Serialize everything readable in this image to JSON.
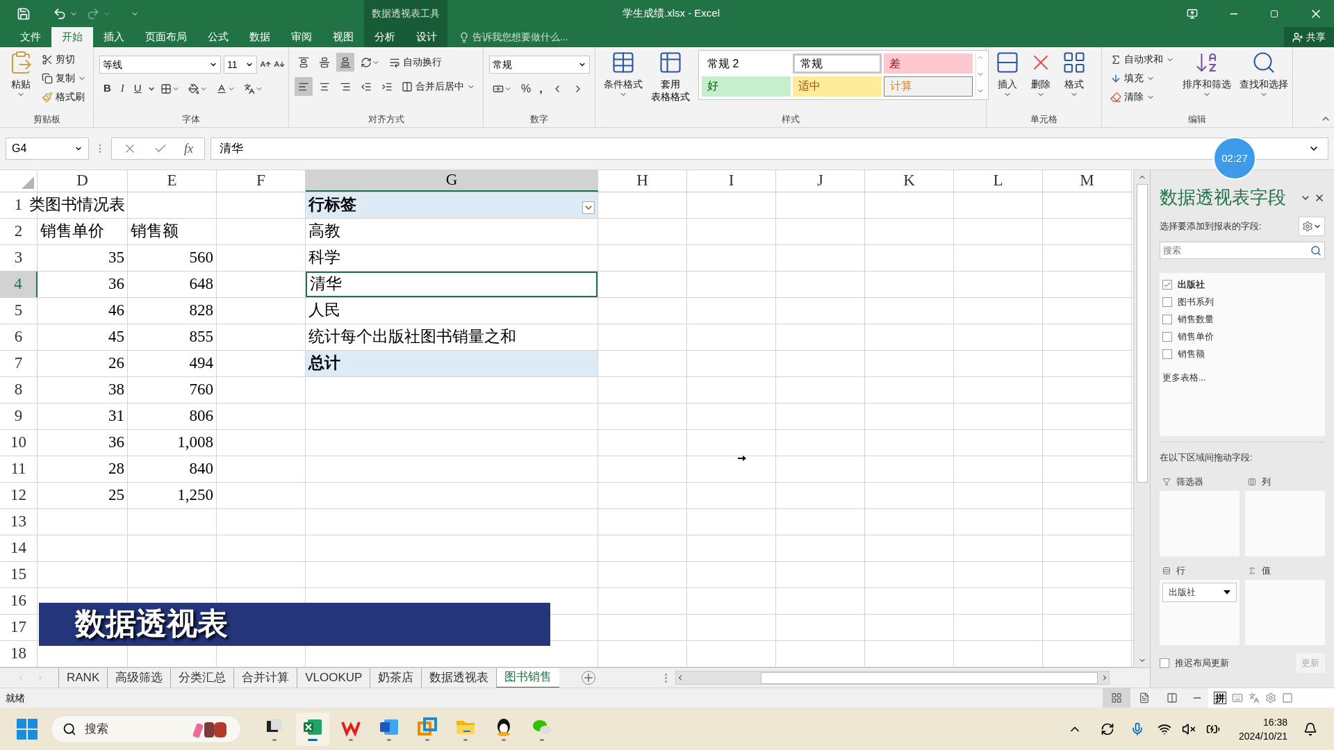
{
  "window": {
    "title": "学生成绩.xlsx - Excel",
    "context_tools": "数据透视表工具",
    "share": "共享"
  },
  "menu_tabs": [
    {
      "label": "文件",
      "selected": false,
      "contextual": false
    },
    {
      "label": "开始",
      "selected": true,
      "contextual": false
    },
    {
      "label": "插入",
      "selected": false,
      "contextual": false
    },
    {
      "label": "页面布局",
      "selected": false,
      "contextual": false
    },
    {
      "label": "公式",
      "selected": false,
      "contextual": false
    },
    {
      "label": "数据",
      "selected": false,
      "contextual": false
    },
    {
      "label": "审阅",
      "selected": false,
      "contextual": false
    },
    {
      "label": "视图",
      "selected": false,
      "contextual": false
    },
    {
      "label": "分析",
      "selected": false,
      "contextual": true
    },
    {
      "label": "设计",
      "selected": false,
      "contextual": true
    }
  ],
  "tell_me": {
    "placeholder": "告诉我您想要做什么..."
  },
  "ribbon": {
    "clipboard": {
      "label": "剪贴板",
      "paste": "粘贴",
      "cut": "剪切",
      "copy": "复制",
      "format_painter": "格式刷"
    },
    "font": {
      "label": "字体",
      "font_name": "等线",
      "font_size": "11",
      "bold": "B",
      "italic": "I",
      "underline": "U"
    },
    "alignment": {
      "label": "对齐方式",
      "wrap_text": "自动换行",
      "merge_center": "合并后居中",
      "vertical": [
        {
          "selected": false
        },
        {
          "selected": false
        },
        {
          "selected": true
        }
      ],
      "horizontal": [
        {
          "selected": true
        },
        {
          "selected": false
        },
        {
          "selected": false
        }
      ]
    },
    "number": {
      "label": "数字",
      "format": "常规",
      "percent": "%",
      "comma": ","
    },
    "styles": {
      "label": "样式",
      "conditional": "条件格式",
      "table_format": [
        "套用",
        "表格格式"
      ],
      "gallery": [
        {
          "text": "常规 2",
          "kind": "normal2",
          "selected": false
        },
        {
          "text": "常规",
          "kind": "normal",
          "selected": true
        },
        {
          "text": "差",
          "kind": "bad",
          "selected": false
        },
        {
          "text": "好",
          "kind": "good",
          "selected": false
        },
        {
          "text": "适中",
          "kind": "neutral",
          "selected": false
        },
        {
          "text": "计算",
          "kind": "calc",
          "selected": false
        }
      ]
    },
    "cells": {
      "label": "单元格",
      "buttons": [
        "插入",
        "删除",
        "格式"
      ]
    },
    "editing": {
      "label": "编辑",
      "autosum": "自动求和",
      "fill": "填充",
      "clear": "清除",
      "sort_filter": "排序和筛选",
      "find_select": "查找和选择"
    }
  },
  "formula_bar": {
    "name_box": "G4",
    "fx": "fx",
    "value": "清华"
  },
  "columns": [
    {
      "label": "D",
      "selected": false
    },
    {
      "label": "E",
      "selected": false
    },
    {
      "label": "F",
      "selected": false
    },
    {
      "label": "G",
      "selected": true
    },
    {
      "label": "H",
      "selected": false
    },
    {
      "label": "I",
      "selected": false
    },
    {
      "label": "J",
      "selected": false
    },
    {
      "label": "K",
      "selected": false
    },
    {
      "label": "L",
      "selected": false
    },
    {
      "label": "M",
      "selected": false
    }
  ],
  "rows": [
    {
      "number": "1",
      "selected": false,
      "D": {
        "text": "类图书情况表",
        "kind": "title",
        "selected": false
      },
      "G": {
        "text": "行标签",
        "kind": "pivot-header",
        "selected": false
      }
    },
    {
      "number": "2",
      "selected": false,
      "D": {
        "text": "销售单价",
        "kind": "header",
        "selected": false
      },
      "E": {
        "text": "销售额",
        "kind": "header",
        "selected": false
      },
      "G": {
        "text": "高教",
        "kind": "pivot-item",
        "selected": false
      }
    },
    {
      "number": "3",
      "selected": false,
      "D": {
        "text": "35",
        "kind": "number",
        "selected": false
      },
      "E": {
        "text": "560",
        "kind": "number",
        "selected": false
      },
      "G": {
        "text": "科学",
        "kind": "pivot-item",
        "selected": false
      }
    },
    {
      "number": "4",
      "selected": true,
      "D": {
        "text": "36",
        "kind": "number",
        "selected": false
      },
      "E": {
        "text": "648",
        "kind": "number",
        "selected": false
      },
      "G": {
        "text": "清华",
        "kind": "pivot-item",
        "selected": true
      }
    },
    {
      "number": "5",
      "selected": false,
      "D": {
        "text": "46",
        "kind": "number",
        "selected": false
      },
      "E": {
        "text": "828",
        "kind": "number",
        "selected": false
      },
      "G": {
        "text": "人民",
        "kind": "pivot-item",
        "selected": false
      }
    },
    {
      "number": "6",
      "selected": false,
      "D": {
        "text": "45",
        "kind": "number",
        "selected": false
      },
      "E": {
        "text": "855",
        "kind": "number",
        "selected": false
      },
      "G": {
        "text": "统计每个出版社图书销量之和",
        "kind": "pivot-item",
        "selected": false
      }
    },
    {
      "number": "7",
      "selected": false,
      "D": {
        "text": "26",
        "kind": "number",
        "selected": false
      },
      "E": {
        "text": "494",
        "kind": "number",
        "selected": false
      },
      "G": {
        "text": "总计",
        "kind": "pivot-total",
        "selected": false
      }
    },
    {
      "number": "8",
      "selected": false,
      "D": {
        "text": "38",
        "kind": "number",
        "selected": false
      },
      "E": {
        "text": "760",
        "kind": "number",
        "selected": false
      }
    },
    {
      "number": "9",
      "selected": false,
      "D": {
        "text": "31",
        "kind": "number",
        "selected": false
      },
      "E": {
        "text": "806",
        "kind": "number",
        "selected": false
      }
    },
    {
      "number": "10",
      "selected": false,
      "D": {
        "text": "36",
        "kind": "number",
        "selected": false
      },
      "E": {
        "text": "1,008",
        "kind": "number",
        "selected": false
      }
    },
    {
      "number": "11",
      "selected": false,
      "D": {
        "text": "28",
        "kind": "number",
        "selected": false
      },
      "E": {
        "text": "840",
        "kind": "number",
        "selected": false
      }
    },
    {
      "number": "12",
      "selected": false,
      "D": {
        "text": "25",
        "kind": "number",
        "selected": false
      },
      "E": {
        "text": "1,250",
        "kind": "number",
        "selected": false
      }
    },
    {
      "number": "13",
      "selected": false
    },
    {
      "number": "14",
      "selected": false
    },
    {
      "number": "15",
      "selected": false
    },
    {
      "number": "16",
      "selected": false
    },
    {
      "number": "17",
      "selected": false
    },
    {
      "number": "18",
      "selected": false
    }
  ],
  "banner": {
    "text": "数据透视表"
  },
  "timer": "02:27",
  "sheet_tabs": [
    {
      "label": "RANK",
      "selected": false
    },
    {
      "label": "高级筛选",
      "selected": false
    },
    {
      "label": "分类汇总",
      "selected": false
    },
    {
      "label": "合并计算",
      "selected": false
    },
    {
      "label": "VLOOKUP",
      "selected": false
    },
    {
      "label": "奶茶店",
      "selected": false
    },
    {
      "label": "数据透视表",
      "selected": false
    },
    {
      "label": "图书销售",
      "selected": true
    }
  ],
  "status_bar": {
    "status": "就绪",
    "ime": "拼"
  },
  "pivot_pane": {
    "title": "数据透视表字段",
    "subtitle": "选择要添加到报表的字段:",
    "search": {
      "placeholder": "搜索"
    },
    "fields": [
      {
        "label": "出版社",
        "checked": true
      },
      {
        "label": "图书系列",
        "checked": false
      },
      {
        "label": "销售数量",
        "checked": false
      },
      {
        "label": "销售单价",
        "checked": false
      },
      {
        "label": "销售额",
        "checked": false
      }
    ],
    "more_tables": "更多表格...",
    "drag_hint": "在以下区域间拖动字段:",
    "areas": [
      {
        "label": "筛选器",
        "kind": "filters"
      },
      {
        "label": "列",
        "kind": "columns"
      },
      {
        "label": "行",
        "kind": "rows",
        "items": [
          "出版社"
        ]
      },
      {
        "label": "值",
        "kind": "values"
      }
    ],
    "defer": {
      "label": "推迟布局更新",
      "checked": false
    },
    "update": {
      "label": "更新",
      "disabled": true
    }
  },
  "taskbar": {
    "search": {
      "placeholder": "搜索"
    },
    "time": "16:38",
    "date": "2024/10/21"
  }
}
